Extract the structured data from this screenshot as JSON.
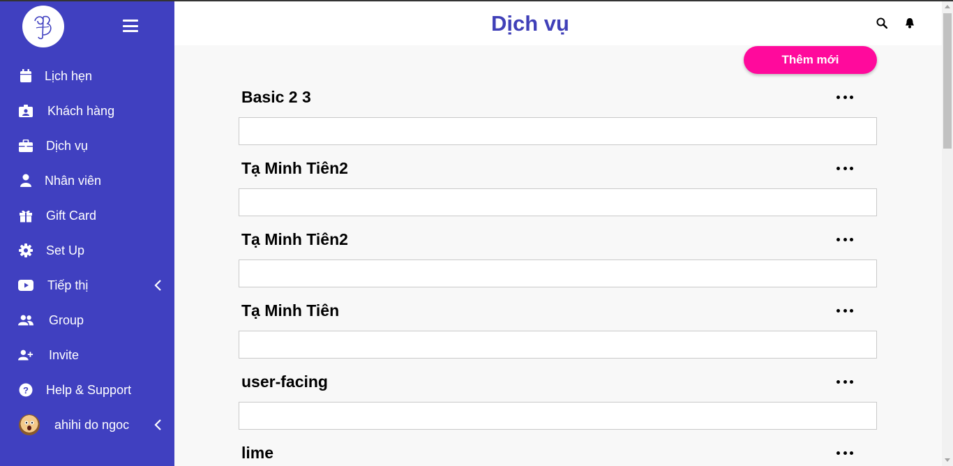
{
  "header": {
    "title": "Dịch vụ"
  },
  "sidebar": {
    "items": [
      {
        "label": "Lịch hẹn"
      },
      {
        "label": "Khách hàng"
      },
      {
        "label": "Dịch vụ"
      },
      {
        "label": "Nhân viên"
      },
      {
        "label": "Gift Card"
      },
      {
        "label": "Set Up"
      },
      {
        "label": "Tiếp thị"
      },
      {
        "label": "Group"
      },
      {
        "label": "Invite"
      },
      {
        "label": "Help & Support"
      }
    ],
    "user": {
      "name": "ahihi do ngoc"
    }
  },
  "toolbar": {
    "add_label": "Thêm mới"
  },
  "services": [
    {
      "name": "Basic 2 3"
    },
    {
      "name": "Tạ Minh Tiên2"
    },
    {
      "name": "Tạ Minh Tiên2"
    },
    {
      "name": "Tạ Minh Tiên"
    },
    {
      "name": "user-facing"
    },
    {
      "name": "lime"
    }
  ],
  "colors": {
    "sidebar": "#4040c0",
    "accent": "#ff0a9c",
    "title": "#4040b8"
  },
  "icons": [
    "logo",
    "menu-icon",
    "calendar-icon",
    "id-card-icon",
    "briefcase-icon",
    "user-icon",
    "gift-icon",
    "gear-icon",
    "youtube-icon",
    "users-icon",
    "user-plus-icon",
    "help-icon",
    "chevron-left-icon",
    "search-icon",
    "bell-icon",
    "more-icon"
  ]
}
